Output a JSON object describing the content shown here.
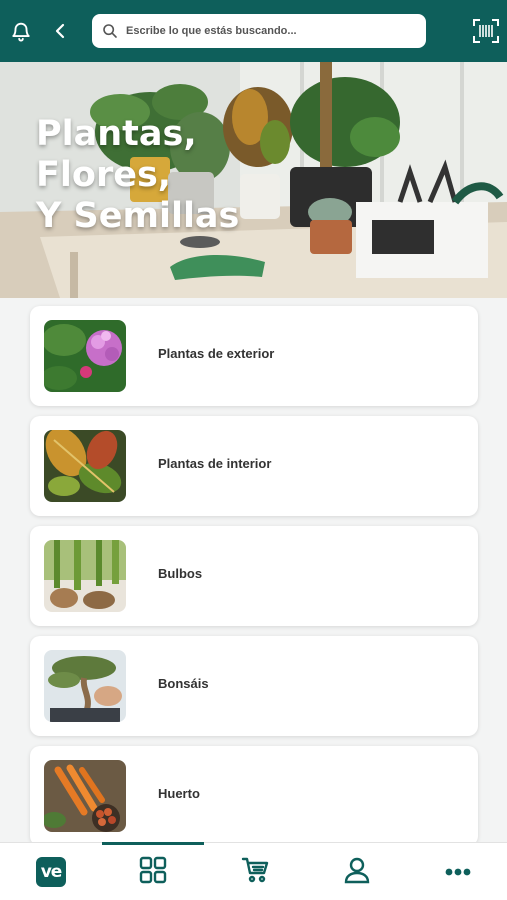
{
  "search": {
    "placeholder": "Escribe lo que estás buscando..."
  },
  "hero": {
    "title_lines": [
      "Plantas,",
      "Flores,",
      "Y Semillas"
    ]
  },
  "categories": [
    {
      "label": "Plantas de exterior"
    },
    {
      "label": "Plantas de interior"
    },
    {
      "label": "Bulbos"
    },
    {
      "label": "Bonsáis"
    },
    {
      "label": "Huerto"
    }
  ],
  "nav": {
    "logo_text": "ve",
    "active_index": 1
  },
  "colors": {
    "brand": "#0e5f5b",
    "background": "#f3f4f4"
  },
  "icons": [
    "bell-icon",
    "back-chevron-icon",
    "search-icon",
    "barcode-scan-icon",
    "grid-icon",
    "cart-icon",
    "user-icon",
    "more-icon"
  ]
}
